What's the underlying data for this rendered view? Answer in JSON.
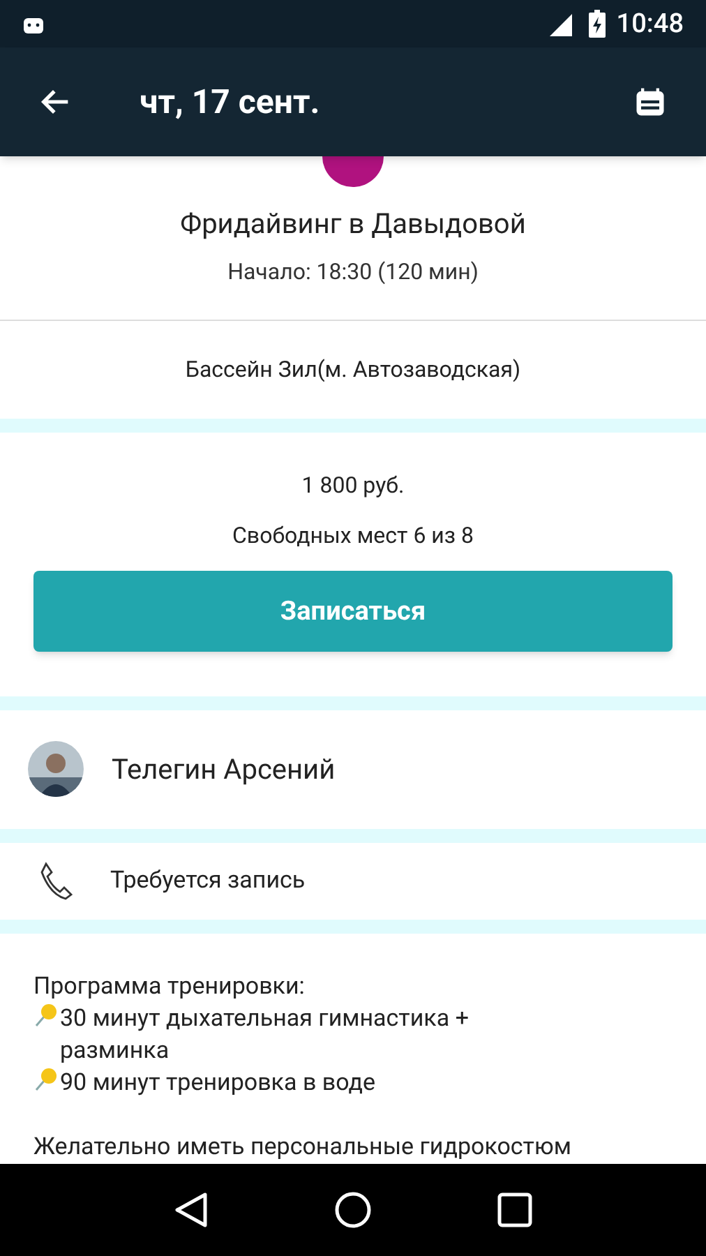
{
  "status_bar": {
    "time": "10:48"
  },
  "toolbar": {
    "title": "чт, 17 сент."
  },
  "event": {
    "title": "Фридайвинг в Давыдовой",
    "start": "Начало: 18:30 (120 мин)",
    "color": "#b0127f"
  },
  "location": "Бассейн Зил(м. Автозаводская)",
  "price": "1 800 руб.",
  "seats": "Свободных мест 6 из 8",
  "signup_button": "Записаться",
  "trainer": {
    "name": "Телегин Арсений"
  },
  "registration": "Требуется запись",
  "program": {
    "heading": "Программа тренировки:",
    "items": [
      "30 минут дыхательная гимнастика + разминка",
      "90 минут тренировка в воде"
    ],
    "note": "Желательно иметь персональные гидрокостюм"
  }
}
